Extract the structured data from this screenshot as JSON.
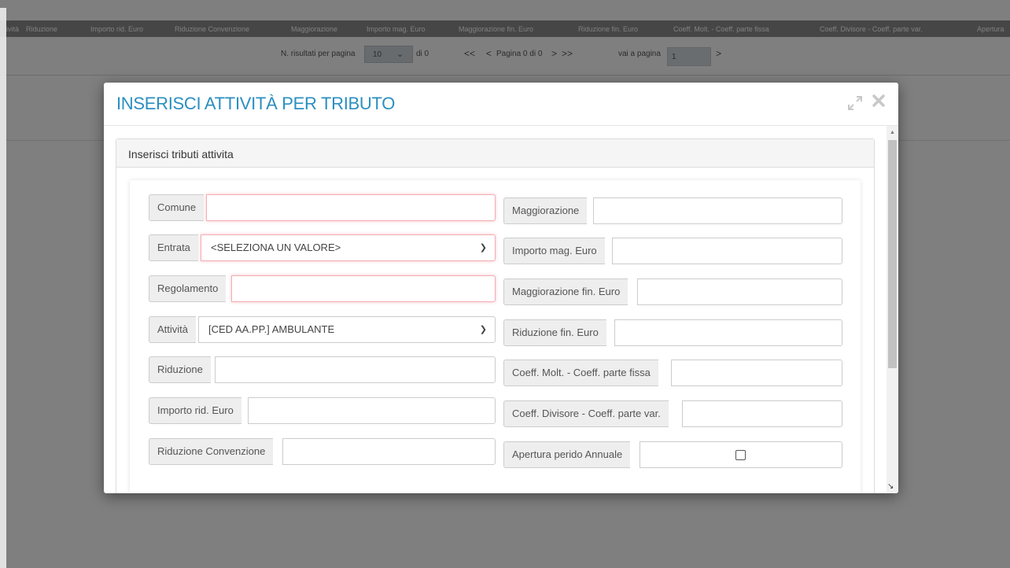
{
  "grid": {
    "columns": [
      "ività",
      "Riduzione",
      "Importo rid. Euro",
      "Riduzione Convenzione",
      "Maggiorazione",
      "Importo mag. Euro",
      "Maggiorazione fin. Euro",
      "Riduzione fin. Euro",
      "Coeff. Molt. - Coeff. parte fissa",
      "Coeff. Divisore - Coeff. parte var.",
      "Apertura"
    ]
  },
  "pager": {
    "results_per_page_label": "N. risultati per pagina",
    "results_per_page_value": "10",
    "of_label": "di 0",
    "first": "<<",
    "prev": "<",
    "page_info": "Pagina 0 di 0",
    "next": ">",
    "last": ">>",
    "goto_label": "vai a pagina",
    "goto_value": "1",
    "goto_button": ">"
  },
  "modal": {
    "title": "INSERISCI ATTIVITÀ PER TRIBUTO",
    "panel_heading": "Inserisci tributi attivita",
    "left_fields": [
      {
        "label": "Comune",
        "value": ""
      },
      {
        "label": "Entrata",
        "value": "<SELEZIONA UN VALORE>"
      },
      {
        "label": "Regolamento",
        "value": ""
      },
      {
        "label": "Attività",
        "value": "[CED AA.PP.] AMBULANTE"
      },
      {
        "label": "Riduzione",
        "value": ""
      },
      {
        "label": "Importo rid. Euro",
        "value": ""
      },
      {
        "label": "Riduzione Convenzione",
        "value": ""
      }
    ],
    "right_fields": [
      {
        "label": "Maggiorazione",
        "value": ""
      },
      {
        "label": "Importo mag. Euro",
        "value": ""
      },
      {
        "label": "Maggiorazione fin. Euro",
        "value": ""
      },
      {
        "label": "Riduzione fin. Euro",
        "value": ""
      },
      {
        "label": "Coeff. Molt. - Coeff. parte fissa",
        "value": ""
      },
      {
        "label": "Coeff. Divisore - Coeff. parte var.",
        "value": ""
      },
      {
        "label": "Apertura perido Annuale",
        "checked": false
      }
    ]
  },
  "icons": {
    "expand": "expand-icon",
    "close": "close-icon",
    "dropdown": "chevron-down-icon"
  },
  "colors": {
    "title": "#2b8fc1",
    "grid_header": "#8d8d8d",
    "required_border": "#f2aeb4"
  }
}
